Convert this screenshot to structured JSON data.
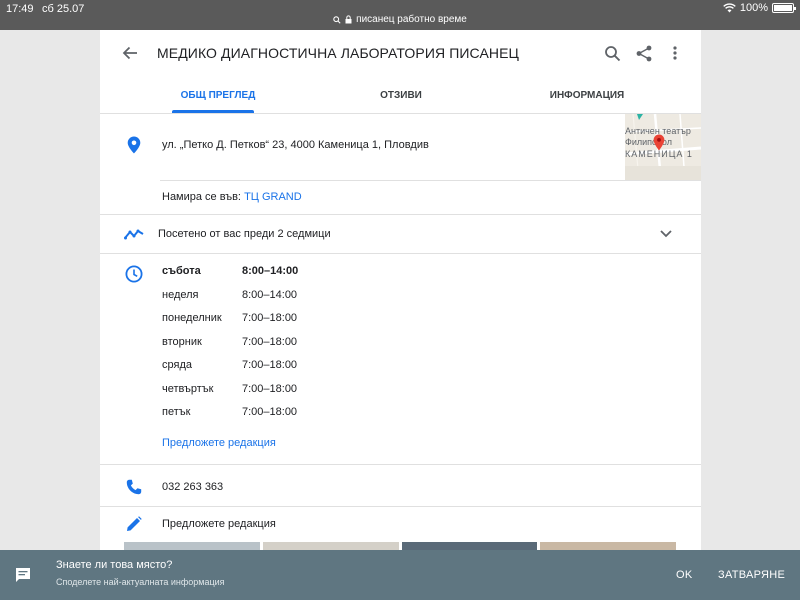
{
  "status_bar": {
    "time": "17:49",
    "date": "сб 25.07",
    "url": "писанец работно време",
    "battery": "100%"
  },
  "header": {
    "title": "МЕДИКО ДИАГНОСТИЧНА ЛАБОРАТОРИЯ ПИСАНЕЦ",
    "icons": [
      "back-arrow-icon",
      "search-icon",
      "share-icon",
      "more-vert-icon"
    ]
  },
  "tabs": [
    {
      "label": "ОБЩ ПРЕГЛЕД",
      "active": true
    },
    {
      "label": "ОТЗИВИ",
      "active": false
    },
    {
      "label": "ИНФОРМАЦИЯ",
      "active": false
    }
  ],
  "address": {
    "text": "ул. „Петко Д. Петков“ 23, 4000 Каменица 1, Пловдив",
    "located_in_label": "Намира се във:",
    "located_in_link": "ТЦ GRAND"
  },
  "map_thumbnail": {
    "line1": "Античен театър",
    "line2": "Филипопол",
    "line3": "КАМЕНИЦА 1"
  },
  "visited": {
    "text": "Посетено от вас преди 2 седмици"
  },
  "hours": [
    {
      "day": "събота",
      "time": "8:00–14:00",
      "current": true
    },
    {
      "day": "неделя",
      "time": "8:00–14:00",
      "current": false
    },
    {
      "day": "понеделник",
      "time": "7:00–18:00",
      "current": false
    },
    {
      "day": "вторник",
      "time": "7:00–18:00",
      "current": false
    },
    {
      "day": "сряда",
      "time": "7:00–18:00",
      "current": false
    },
    {
      "day": "четвъртък",
      "time": "7:00–18:00",
      "current": false
    },
    {
      "day": "петък",
      "time": "7:00–18:00",
      "current": false
    }
  ],
  "suggest_edit_hours": "Предложете редакция",
  "phone": "032 263 363",
  "suggest_edit": "Предложете редакция",
  "snackbar": {
    "title": "Знаете ли това място?",
    "subtitle": "Споделете най-актуалната информация",
    "ok_label": "OK",
    "close_label": "ЗАТВАРЯНЕ"
  },
  "colors": {
    "accent": "#1a73e8",
    "snackbar_bg": "#5f7681",
    "status_bar_bg": "#5a5a5a"
  }
}
